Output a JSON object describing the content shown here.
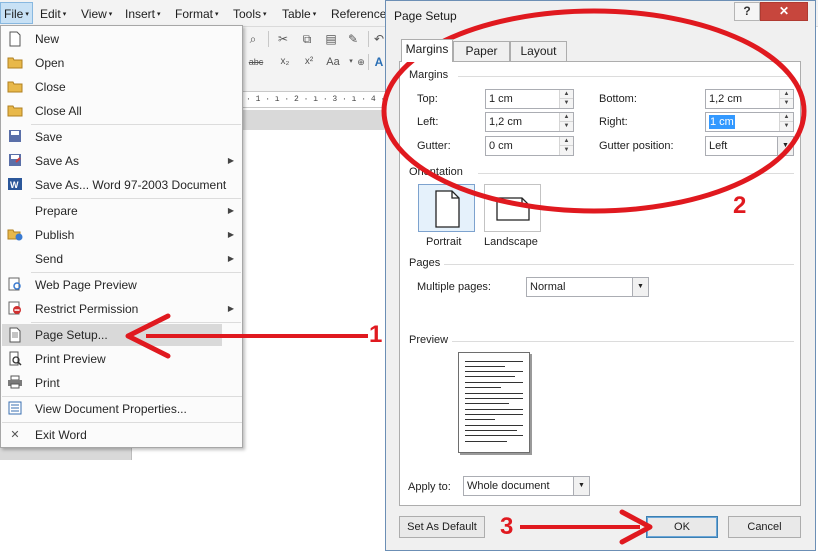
{
  "menubar": {
    "items": [
      {
        "label": "File",
        "caret": "▾"
      },
      {
        "label": "Edit",
        "caret": "▾"
      },
      {
        "label": "View",
        "caret": "▾"
      },
      {
        "label": "Insert",
        "caret": "▾"
      },
      {
        "label": "Format",
        "caret": "▾"
      },
      {
        "label": "Tools",
        "caret": "▾"
      },
      {
        "label": "Table",
        "caret": "▾"
      },
      {
        "label": "Reference",
        "caret": ""
      }
    ]
  },
  "ruler": {
    "text": "· 1 · ı · 2 · ı · 3 · ı · 4 ·"
  },
  "file_menu": {
    "items": [
      {
        "label": "New",
        "icon": "new-document-icon"
      },
      {
        "label": "Open",
        "icon": "open-folder-icon"
      },
      {
        "label": "Close",
        "icon": "close-folder-icon"
      },
      {
        "label": "Close All",
        "icon": "close-all-folder-icon"
      },
      {
        "label": "Save",
        "icon": "save-icon"
      },
      {
        "label": "Save As",
        "icon": "save-as-icon",
        "submenu": true
      },
      {
        "label": "Save As... Word 97-2003 Document",
        "icon": "word-document-icon"
      },
      {
        "label": "Prepare",
        "submenu": true
      },
      {
        "label": "Publish",
        "icon": "publish-icon",
        "submenu": true
      },
      {
        "label": "Send",
        "submenu": true
      },
      {
        "label": "Web Page Preview",
        "icon": "web-preview-icon"
      },
      {
        "label": "Restrict Permission",
        "icon": "restrict-permission-icon",
        "submenu": true
      },
      {
        "label": "Page Setup...",
        "icon": "page-setup-icon",
        "highlighted": true
      },
      {
        "label": "Print Preview",
        "icon": "print-preview-icon"
      },
      {
        "label": "Print",
        "icon": "printer-icon"
      },
      {
        "label": "View Document Properties...",
        "icon": "document-properties-icon"
      },
      {
        "label": "Exit Word",
        "icon": "exit-icon"
      }
    ]
  },
  "dialog": {
    "title": "Page Setup",
    "help_label": "?",
    "close_label": "✕",
    "tabs": [
      "Margins",
      "Paper",
      "Layout"
    ],
    "margins": {
      "section_label": "Margins",
      "top_label": "Top:",
      "top_value": "1 cm",
      "bottom_label": "Bottom:",
      "bottom_value": "1,2 cm",
      "left_label": "Left:",
      "left_value": "1,2 cm",
      "right_label": "Right:",
      "right_value": "1 cm",
      "gutter_label": "Gutter:",
      "gutter_value": "0 cm",
      "gutter_position_label": "Gutter position:",
      "gutter_position_value": "Left"
    },
    "orientation": {
      "section_label": "Orientation",
      "portrait_label": "Portrait",
      "landscape_label": "Landscape"
    },
    "pages": {
      "section_label": "Pages",
      "multiple_pages_label": "Multiple pages:",
      "multiple_pages_value": "Normal"
    },
    "preview": {
      "section_label": "Preview"
    },
    "apply_to": {
      "label": "Apply to:",
      "value": "Whole document"
    },
    "buttons": {
      "set_default": "Set As Default",
      "ok": "OK",
      "cancel": "Cancel"
    }
  },
  "annotations": {
    "step1": "1",
    "step2": "2",
    "step3": "3",
    "color": "#e0191f"
  }
}
